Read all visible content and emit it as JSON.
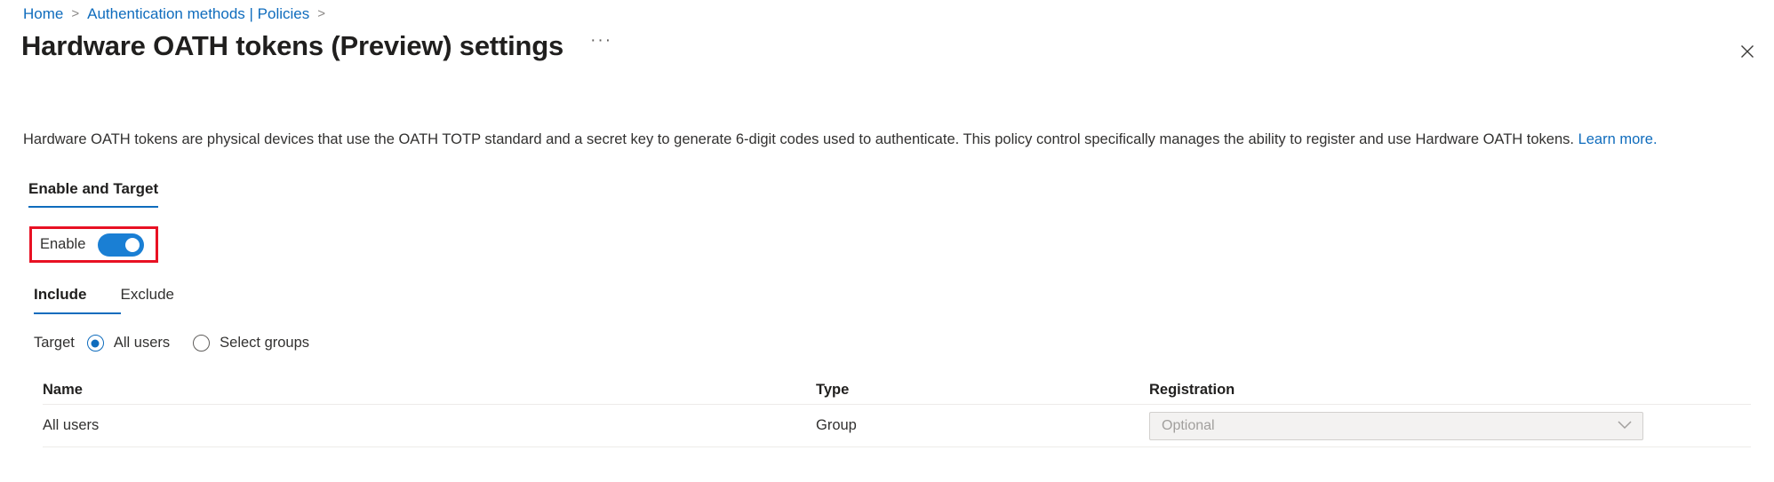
{
  "breadcrumb": {
    "items": [
      {
        "label": "Home",
        "separator": ">"
      },
      {
        "label": "Authentication methods | Policies",
        "separator": ">"
      }
    ]
  },
  "header": {
    "title": "Hardware OATH tokens (Preview) settings",
    "more_actions": "···",
    "close_icon": "close-icon"
  },
  "description": {
    "text": "Hardware OATH tokens are physical devices that use the OATH TOTP standard and a secret key to generate 6-digit codes used to authenticate. This policy control specifically manages the ability to register and use Hardware OATH tokens. ",
    "link_label": "Learn more."
  },
  "pivot": {
    "tabs": [
      {
        "label": "Enable and Target",
        "selected": true
      }
    ]
  },
  "enable": {
    "label": "Enable",
    "toggle_state": "on",
    "annotation_color": "#e81123"
  },
  "subtabs": [
    {
      "label": "Include",
      "selected": true
    },
    {
      "label": "Exclude",
      "selected": false
    }
  ],
  "target": {
    "label": "Target",
    "options": [
      {
        "label": "All users",
        "selected": true
      },
      {
        "label": "Select groups",
        "selected": false
      }
    ]
  },
  "table": {
    "columns": [
      "Name",
      "Type",
      "Registration"
    ],
    "rows": [
      {
        "name": "All users",
        "type": "Group",
        "registration": "Optional",
        "registration_disabled": true
      }
    ]
  },
  "colors": {
    "accent": "#0f6cbd",
    "toggle_on": "#1a7fd4",
    "link": "#0f6cbd",
    "annotation": "#e81123",
    "disabled_bg": "#f3f2f1",
    "disabled_text": "#a19f9d"
  }
}
